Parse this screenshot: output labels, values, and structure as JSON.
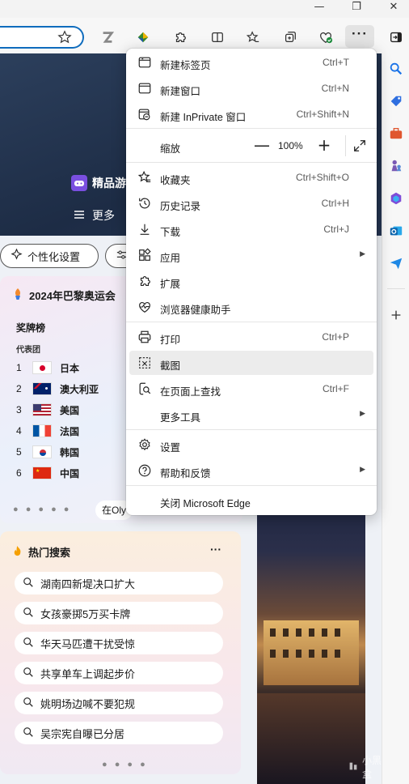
{
  "window": {
    "controls": [
      "—",
      "❐",
      "✕"
    ]
  },
  "toolbar": {
    "icons": [
      "favorite-star-icon",
      "z-extension-icon",
      "gem-extension-icon",
      "puzzle-extensions-icon",
      "split-screen-icon",
      "favorites-icon",
      "collections-icon",
      "browser-essentials-icon"
    ],
    "more_label": "···"
  },
  "hero": {
    "row1": "精品游",
    "row2": "更多"
  },
  "pills": {
    "personalize": "个性化设置"
  },
  "olympic": {
    "title": "2024年巴黎奥运会",
    "medal_header": "奖牌榜",
    "sub_header": "代表团",
    "ranks": [
      {
        "rank": "1",
        "country": "日本"
      },
      {
        "rank": "2",
        "country": "澳大利亚"
      },
      {
        "rank": "3",
        "country": "美国"
      },
      {
        "rank": "4",
        "country": "法国"
      },
      {
        "rank": "5",
        "country": "韩国"
      },
      {
        "rank": "6",
        "country": "中国"
      }
    ],
    "link": "在Oly"
  },
  "hot": {
    "title": "热门搜索",
    "more": "···",
    "items": [
      "湖南四新堤决口扩大",
      "女孩豪掷5万买卡牌",
      "华天马匹遭干扰受惊",
      "共享单车上调起步价",
      "姚明场边喊不要犯规",
      "吴宗宪自曝已分居"
    ]
  },
  "watermark": "小黑盒",
  "menu": {
    "items": [
      {
        "label": "新建标签页",
        "shortcut": "Ctrl+T",
        "icon": "new-tab-icon"
      },
      {
        "label": "新建窗口",
        "shortcut": "Ctrl+N",
        "icon": "new-window-icon"
      },
      {
        "label": "新建 InPrivate 窗口",
        "shortcut": "Ctrl+Shift+N",
        "icon": "inprivate-icon"
      },
      {
        "label": "缩放",
        "icon": ""
      },
      {
        "label": "收藏夹",
        "shortcut": "Ctrl+Shift+O",
        "icon": "favorites-icon"
      },
      {
        "label": "历史记录",
        "shortcut": "Ctrl+H",
        "icon": "history-icon"
      },
      {
        "label": "下载",
        "shortcut": "Ctrl+J",
        "icon": "download-icon"
      },
      {
        "label": "应用",
        "icon": "apps-icon"
      },
      {
        "label": "扩展",
        "icon": "extensions-icon"
      },
      {
        "label": "浏览器健康助手",
        "icon": "health-icon"
      },
      {
        "label": "打印",
        "shortcut": "Ctrl+P",
        "icon": "print-icon"
      },
      {
        "label": "截图",
        "icon": "screenshot-icon"
      },
      {
        "label": "在页面上查找",
        "shortcut": "Ctrl+F",
        "icon": "find-icon"
      },
      {
        "label": "更多工具",
        "icon": ""
      },
      {
        "label": "设置",
        "icon": "settings-icon"
      },
      {
        "label": "帮助和反馈",
        "icon": "help-icon"
      },
      {
        "label": "关闭 Microsoft Edge",
        "icon": ""
      }
    ],
    "zoom": {
      "minus": "—",
      "value": "100%",
      "plus": "+"
    },
    "submenu_arrow": "▶"
  },
  "colors": {
    "accent": "#0f6cbd",
    "menu_bg": "#ffffff",
    "hero": "#1d2c45"
  }
}
